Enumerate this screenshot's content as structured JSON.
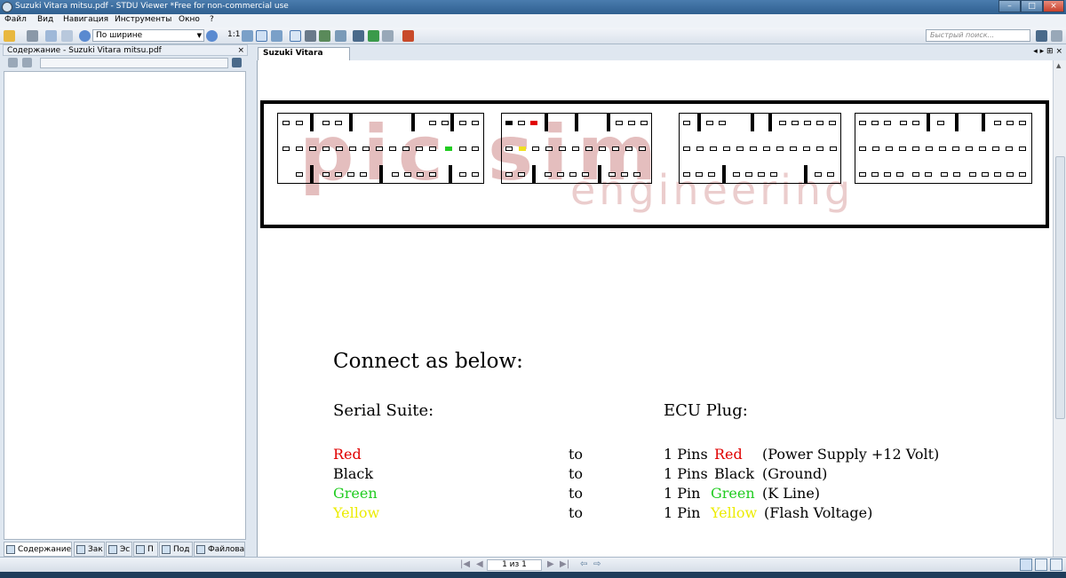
{
  "window": {
    "title": "Suzuki Vitara mitsu.pdf - STDU Viewer *Free for non-commercial use"
  },
  "menu": [
    "Файл",
    "Вид",
    "Навигация",
    "Инструменты",
    "Окно",
    "?"
  ],
  "toolbar": {
    "zoom_value": "По ширине",
    "actual_size_label": "1:1",
    "search_placeholder": "Быстрый поиск..."
  },
  "sidebar": {
    "header": "Содержание - Suzuki Vitara mitsu.pdf",
    "close": "×",
    "tabs": [
      "Содержание",
      "Зак",
      "Эс",
      "П",
      "Под",
      "Файлова"
    ]
  },
  "document": {
    "tab_label": "Suzuki Vitara mitsu.pdf",
    "tab_controls": "◂ ▸ ⊞ ×",
    "watermark_top": "pic sim",
    "watermark_bottom": "engineering",
    "heading": "Connect as below:",
    "col_left": "Serial Suite:",
    "col_right": "ECU Plug:",
    "rows": [
      {
        "wire": "Red",
        "to": "to",
        "pins": "1 Pins",
        "color": "Red",
        "desc": "(Power Supply +12 Volt)"
      },
      {
        "wire": "Black",
        "to": "to",
        "pins": "1 Pins",
        "color": "Black",
        "desc": "(Ground)"
      },
      {
        "wire": "Green",
        "to": "to",
        "pins": "1 Pin",
        "color": "Green",
        "desc": "(K Line)"
      },
      {
        "wire": "Yellow",
        "to": "to",
        "pins": "1 Pin",
        "color": "Yellow",
        "desc": "(Flash Voltage)"
      }
    ]
  },
  "navbar": {
    "page_indicator": "1 из 1"
  },
  "colors": {
    "red": "#e00000",
    "green": "#22cc22",
    "yellow": "#ecec00",
    "titlebar": "#2f5f8f"
  }
}
